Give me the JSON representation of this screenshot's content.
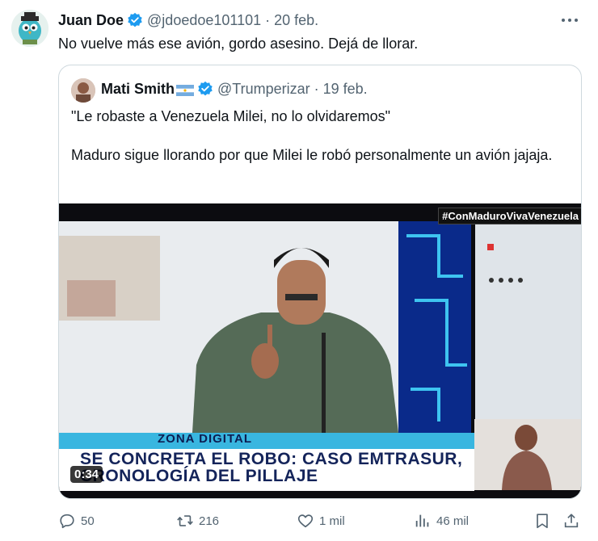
{
  "tweet": {
    "author_name": "Juan Doe",
    "handle": "@jdoedoe101101",
    "separator": "·",
    "date": "20 feb.",
    "more_icon": "more-icon",
    "text": "No vuelve más ese avión, gordo asesino. Dejá de llorar."
  },
  "quote": {
    "author_name": "Mati Smith",
    "handle": "@Trumperizar",
    "separator": "·",
    "date": "19 feb.",
    "paragraphs": [
      "\"Le robaste a Venezuela Milei, no lo olvidaremos\"",
      "Maduro sigue llorando por que Milei le robó personalmente un avión jajaja."
    ]
  },
  "video": {
    "hashtag": "#ConMaduroVivaVenezuela",
    "banner": "ZONA DIGITAL",
    "headline_line1": "SE CONCRETA EL ROBO: CASO EMTRASUR,",
    "headline_line2": "CRONOLOGÍA DEL PILLAJE",
    "duration": "0:34"
  },
  "actions": {
    "replies": "50",
    "retweets": "216",
    "likes": "1 mil",
    "views": "46 mil"
  },
  "colors": {
    "verified": "#1d9bf0",
    "muted_text": "#536471",
    "border": "#cfd9de",
    "headline_blue": "#14245a",
    "banner_cyan": "#39b6e0"
  }
}
